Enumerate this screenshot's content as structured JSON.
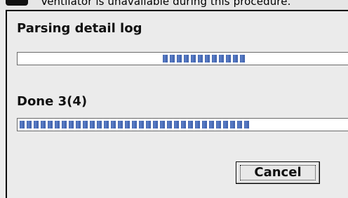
{
  "background_window": {
    "text": "Ventilator is unavailable during this procedure.",
    "icon": "status-badge-icon"
  },
  "dialog": {
    "title": "Parsing detail log",
    "status_text": "Done 3(4)",
    "indeterminate_progress": {
      "mode": "indeterminate",
      "color": "#4a6cb8"
    },
    "overall_progress": {
      "mode": "determinate",
      "fraction": 0.7,
      "color": "#4a6cb8"
    },
    "cancel_label": "Cancel"
  }
}
